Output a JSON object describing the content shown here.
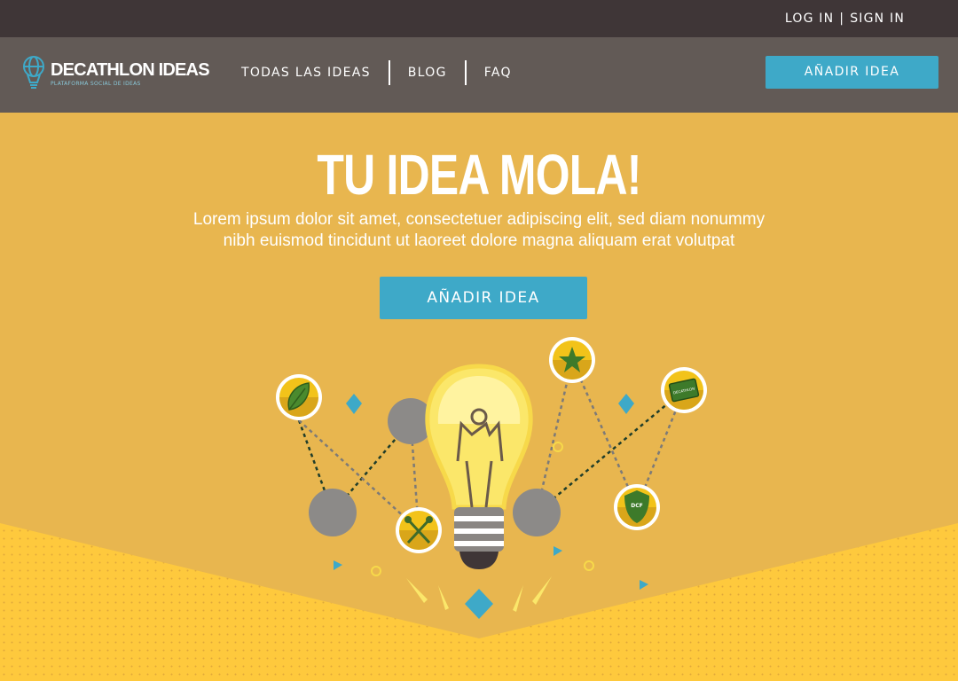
{
  "topbar": {
    "login": "LOG IN",
    "separator": "|",
    "signin": "SIGN IN"
  },
  "brand": {
    "name": "DECATHLON IDEAS",
    "tagline": "PLATAFORMA SOCIAL DE IDEAS",
    "icon": "lightbulb-globe-icon"
  },
  "nav": {
    "items": [
      {
        "label": "TODAS LAS IDEAS"
      },
      {
        "label": "BLOG"
      },
      {
        "label": "FAQ"
      }
    ],
    "cta_label": "AÑADIR IDEA"
  },
  "hero": {
    "title": "TU IDEA MOLA!",
    "text_line1": "Lorem ipsum dolor sit amet, consectetuer adipiscing elit, sed diam nonummy",
    "text_line2": "nibh euismod tincidunt ut laoreet dolore magna aliquam erat volutpat",
    "cta_label": "AÑADIR IDEA"
  },
  "illustration": {
    "icons": [
      "leaf-icon",
      "crossed-tools-icon",
      "star-icon",
      "ticket-icon",
      "shield-icon"
    ],
    "card_label": "DECATHLON",
    "shield_label": "DCF"
  },
  "colors": {
    "topbar": "#3f3637",
    "navbar": "#625a56",
    "hero_bg": "#e8b64f",
    "accent_blue": "#3ea9c8",
    "dots_bg": "#fec93d",
    "bulb": "#fbe76a"
  }
}
